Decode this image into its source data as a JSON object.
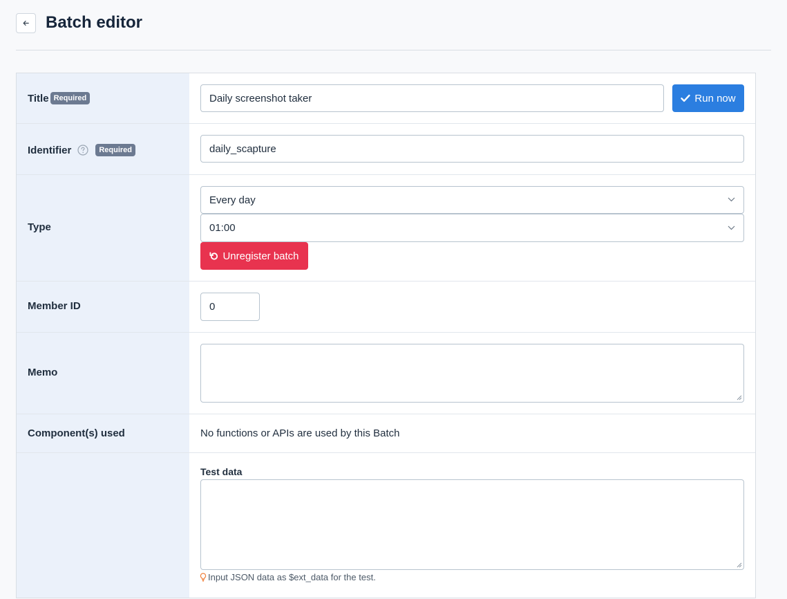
{
  "header": {
    "title": "Batch editor",
    "back_icon": "arrow-left-icon"
  },
  "form": {
    "title_row": {
      "label": "Title",
      "badge": "Required",
      "value": "Daily screenshot taker",
      "run_button": "Run now",
      "run_icon": "check-icon"
    },
    "identifier_row": {
      "label": "Identifier",
      "help_icon": "question-circle-icon",
      "badge": "Required",
      "value": "daily_scapture"
    },
    "type_row": {
      "label": "Type",
      "frequency": "Every day",
      "time": "01:00",
      "unregister_button": "Unregister batch",
      "unregister_icon": "undo-icon"
    },
    "member_row": {
      "label": "Member ID",
      "value": "0"
    },
    "memo_row": {
      "label": "Memo",
      "value": ""
    },
    "components_row": {
      "label": "Component(s) used",
      "text": "No functions or APIs are used by this Batch"
    },
    "test_row": {
      "sub_label": "Test data",
      "value": "",
      "hint": "Input JSON data as $ext_data for the test.",
      "hint_icon": "lightbulb-icon"
    }
  },
  "colors": {
    "primary": "#2b7ee0",
    "danger": "#e8334f",
    "badge": "#6c7a91",
    "label_bg": "#ebf1fa",
    "hint_icon": "#f0803c"
  }
}
